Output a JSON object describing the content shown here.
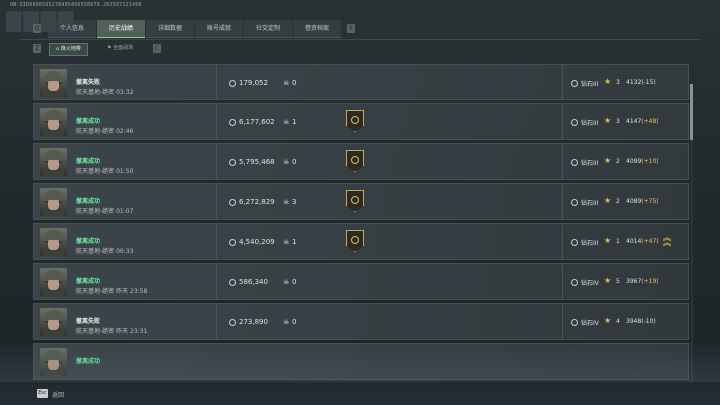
{
  "uid": "ON:UID6898565278495456558079.202507121450",
  "header": {
    "key_left": "Q",
    "key_right": "E",
    "tabs": [
      {
        "label": "个人信息",
        "active": false
      },
      {
        "label": "历史战绩",
        "active": true
      },
      {
        "label": "详细数据",
        "active": false
      },
      {
        "label": "账号成就",
        "active": false
      },
      {
        "label": "社交定制",
        "active": false
      },
      {
        "label": "借资档案",
        "active": false
      }
    ]
  },
  "subbar": {
    "key_left": "Z",
    "key_right": "C",
    "tabs": [
      {
        "label": "烽火地带",
        "active": true
      },
      {
        "label": "全面战场",
        "active": false
      }
    ]
  },
  "matches": [
    {
      "status": "撤离失败",
      "result": "fail",
      "map": "航天基地-绝密",
      "time": "03:32",
      "money": "179,052",
      "kills": "0",
      "medal": false,
      "rank": "钻石III",
      "stars": "3",
      "score": "4132",
      "delta": "(-15)",
      "delta_dir": "down",
      "chevron": false
    },
    {
      "status": "撤离成功",
      "result": "ok",
      "map": "航天基地-绝密",
      "time": "02:46",
      "money": "6,177,602",
      "kills": "1",
      "medal": true,
      "rank": "钻石III",
      "stars": "3",
      "score": "4147",
      "delta": "(+48)",
      "delta_dir": "up",
      "chevron": false
    },
    {
      "status": "撤离成功",
      "result": "ok",
      "map": "航天基地-绝密",
      "time": "01:50",
      "money": "5,795,468",
      "kills": "0",
      "medal": true,
      "rank": "钻石III",
      "stars": "2",
      "score": "4099",
      "delta": "(+10)",
      "delta_dir": "up",
      "chevron": false
    },
    {
      "status": "撤离成功",
      "result": "ok",
      "map": "航天基地-绝密",
      "time": "01:07",
      "money": "6,272,829",
      "kills": "3",
      "medal": true,
      "rank": "钻石III",
      "stars": "2",
      "score": "4089",
      "delta": "(+75)",
      "delta_dir": "up",
      "chevron": false
    },
    {
      "status": "撤离成功",
      "result": "ok",
      "map": "航天基地-绝密",
      "time": "00:33",
      "money": "4,540,209",
      "kills": "1",
      "medal": true,
      "rank": "钻石III",
      "stars": "1",
      "score": "4014",
      "delta": "(+47)",
      "delta_dir": "up",
      "chevron": true
    },
    {
      "status": "撤离成功",
      "result": "ok",
      "map": "航天基地-绝密",
      "time": "昨天 23:58",
      "money": "586,340",
      "kills": "0",
      "medal": false,
      "rank": "钻石IV",
      "stars": "5",
      "score": "3967",
      "delta": "(+19)",
      "delta_dir": "up",
      "chevron": false
    },
    {
      "status": "撤离失败",
      "result": "fail",
      "map": "航天基地-绝密",
      "time": "昨天 23:31",
      "money": "273,890",
      "kills": "0",
      "medal": false,
      "rank": "钻石IV",
      "stars": "4",
      "score": "3948",
      "delta": "(-10)",
      "delta_dir": "down",
      "chevron": false
    },
    {
      "status": "撤离成功",
      "result": "ok",
      "map": "",
      "time": "",
      "money": "",
      "kills": "",
      "medal": false,
      "rank": "",
      "stars": "",
      "score": "",
      "delta": "",
      "delta_dir": "up",
      "chevron": false
    }
  ],
  "footer": {
    "esc_key": "Esc",
    "back_label": "返回"
  }
}
